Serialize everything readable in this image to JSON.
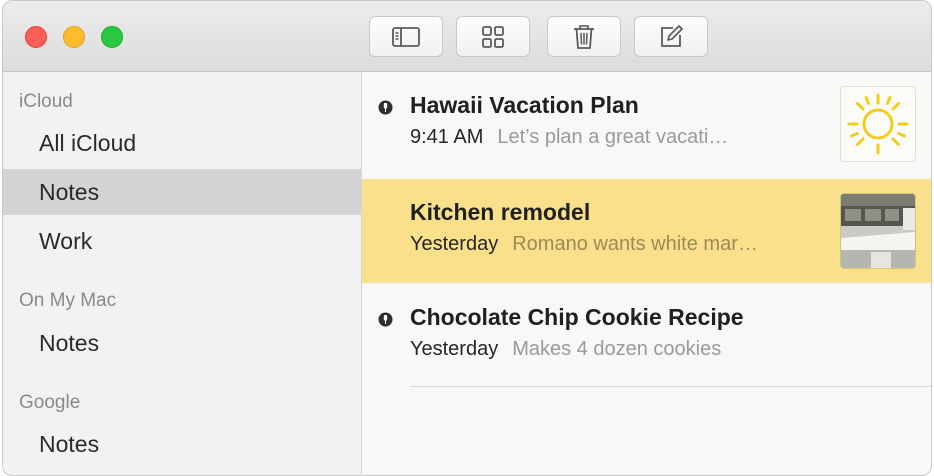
{
  "toolbar": {
    "buttons": [
      {
        "icon": "sidebar-toggle-icon"
      },
      {
        "icon": "gallery-view-icon"
      },
      {
        "icon": "trash-icon"
      },
      {
        "icon": "compose-icon"
      }
    ]
  },
  "sidebar": {
    "sections": [
      {
        "header": "iCloud",
        "items": [
          {
            "label": "All iCloud"
          },
          {
            "label": "Notes",
            "selected": true
          },
          {
            "label": "Work"
          }
        ]
      },
      {
        "header": "On My Mac",
        "items": [
          {
            "label": "Notes"
          }
        ]
      },
      {
        "header": "Google",
        "items": [
          {
            "label": "Notes"
          }
        ]
      }
    ]
  },
  "notes": [
    {
      "title": "Hawaii Vacation Plan",
      "time": "9:41 AM",
      "preview": "Let’s plan a great vacati…",
      "pinned": true,
      "thumbnail": "sun-sketch"
    },
    {
      "title": "Kitchen remodel",
      "time": "Yesterday",
      "preview": "Romano wants white mar…",
      "pinned": false,
      "selected": true,
      "thumbnail": "kitchen-photo"
    },
    {
      "title": "Chocolate Chip Cookie Recipe",
      "time": "Yesterday",
      "preview": "Makes 4 dozen cookies",
      "pinned": true
    }
  ],
  "colors": {
    "selected_note": "#fbe08c",
    "selected_folder": "#d3d3d3",
    "close": "#fc5f57",
    "minimize": "#fdbc2e",
    "zoom": "#28c840"
  }
}
